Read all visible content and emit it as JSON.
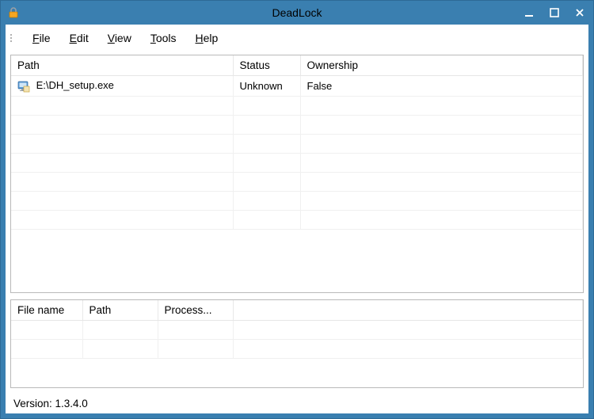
{
  "window": {
    "title": "DeadLock"
  },
  "menubar": {
    "items": [
      {
        "label": "File",
        "mnemonic": "F"
      },
      {
        "label": "Edit",
        "mnemonic": "E"
      },
      {
        "label": "View",
        "mnemonic": "V"
      },
      {
        "label": "Tools",
        "mnemonic": "T"
      },
      {
        "label": "Help",
        "mnemonic": "H"
      }
    ]
  },
  "gridTop": {
    "columns": {
      "path": "Path",
      "status": "Status",
      "ownership": "Ownership"
    },
    "rows": [
      {
        "path": "E:\\DH_setup.exe",
        "status": "Unknown",
        "ownership": "False"
      }
    ]
  },
  "gridBottom": {
    "columns": {
      "fileName": "File name",
      "path": "Path",
      "process": "Process..."
    },
    "rows": []
  },
  "status": {
    "versionLabel": "Version: 1.3.4.0"
  }
}
